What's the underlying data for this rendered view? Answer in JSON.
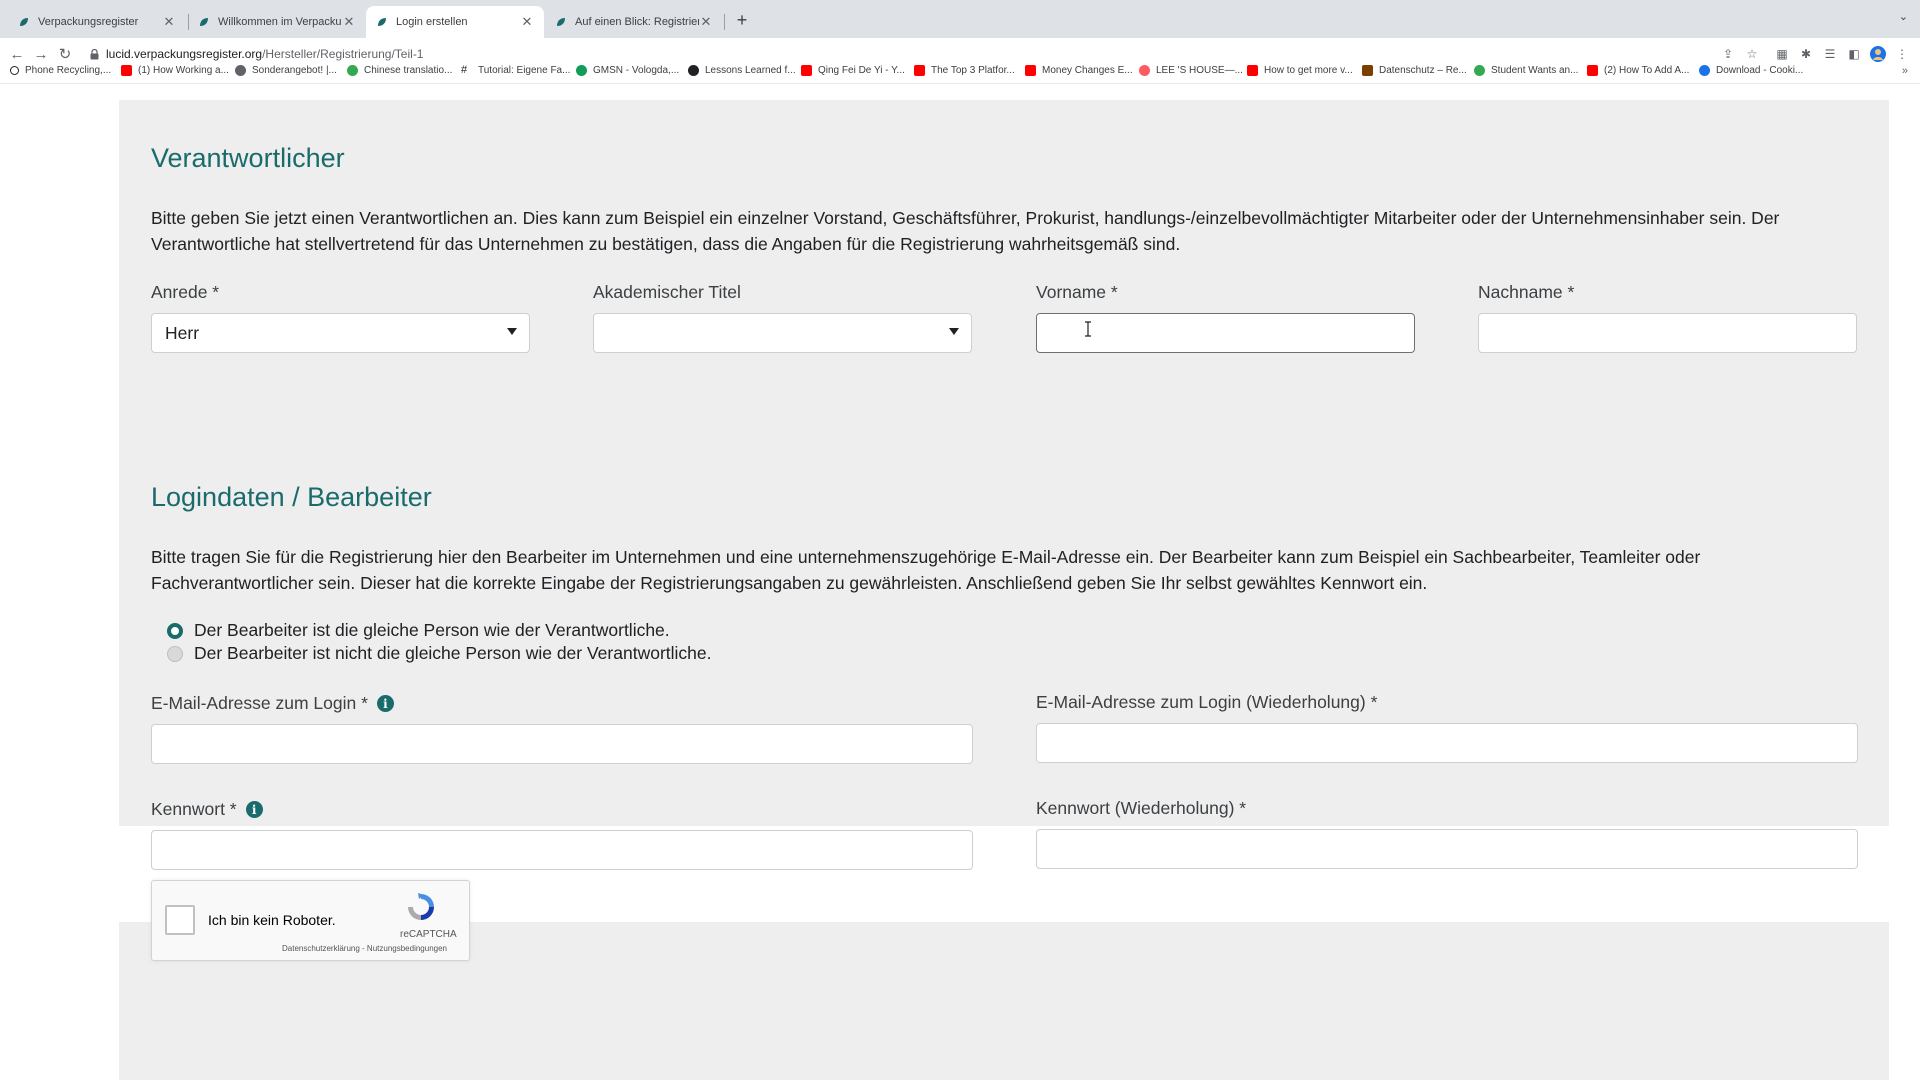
{
  "browser": {
    "tabs": [
      {
        "title": "Verpackungsregister",
        "active": false
      },
      {
        "title": "Willkommen im Verpackungsre",
        "active": false
      },
      {
        "title": "Login erstellen",
        "active": true
      },
      {
        "title": "Auf einen Blick: Registrierung",
        "active": false
      }
    ],
    "url_host": "lucid.verpackungsregister.org",
    "url_path": "/Hersteller/Registrierung/Teil-1",
    "bookmarks": [
      {
        "label": "Phone Recycling,...",
        "icon": "search-icon",
        "color": "#202124"
      },
      {
        "label": "(1) How Working a...",
        "icon": "youtube-icon",
        "color": "#ff0000"
      },
      {
        "label": "Sonderangebot! |...",
        "icon": "site-icon",
        "color": "#5f6368"
      },
      {
        "label": "Chinese translatio...",
        "icon": "site-icon",
        "color": "#34a853"
      },
      {
        "label": "Tutorial: Eigene Fa...",
        "icon": "hashtag-icon",
        "color": "#202124"
      },
      {
        "label": "GMSN - Vologda,...",
        "icon": "site-icon",
        "color": "#0f9d58"
      },
      {
        "label": "Lessons Learned f...",
        "icon": "site-icon",
        "color": "#202124"
      },
      {
        "label": "Qing Fei De Yi - Y...",
        "icon": "youtube-icon",
        "color": "#ff0000"
      },
      {
        "label": "The Top 3 Platfor...",
        "icon": "youtube-icon",
        "color": "#ff0000"
      },
      {
        "label": "Money Changes E...",
        "icon": "youtube-icon",
        "color": "#ff0000"
      },
      {
        "label": "LEE 'S HOUSE—...",
        "icon": "airbnb-icon",
        "color": "#ff5a5f"
      },
      {
        "label": "How to get more v...",
        "icon": "youtube-icon",
        "color": "#ff0000"
      },
      {
        "label": "Datenschutz – Re...",
        "icon": "site-icon",
        "color": "#7b3f00"
      },
      {
        "label": "Student Wants an...",
        "icon": "site-icon",
        "color": "#34a853"
      },
      {
        "label": "(2) How To Add A...",
        "icon": "youtube-icon",
        "color": "#ff0000"
      },
      {
        "label": "Download - Cooki...",
        "icon": "site-icon",
        "color": "#1a73e8"
      }
    ]
  },
  "section_responsible": {
    "title": "Verantwortlicher",
    "intro": "Bitte geben Sie jetzt einen Verantwortlichen an. Dies kann zum Beispiel ein einzelner Vorstand, Geschäftsführer, Prokurist, handlungs-/einzelbevollmächtigter Mitarbeiter oder der Unternehmensinhaber sein. Der Verantwortliche hat stellvertretend für das Unternehmen zu bestätigen, dass die Angaben für die Registrierung wahrheitsgemäß sind.",
    "salutation_label": "Anrede *",
    "salutation_value": "Herr",
    "title_label": "Akademischer Titel",
    "title_value": "",
    "firstname_label": "Vorname *",
    "firstname_value": "",
    "lastname_label": "Nachname *",
    "lastname_value": ""
  },
  "section_login": {
    "title": "Logindaten / Bearbeiter",
    "intro": "Bitte tragen Sie für die Registrierung hier den Bearbeiter im Unternehmen und eine unternehmenszugehörige E-Mail-Adresse ein. Der Bearbeiter kann zum Beispiel ein Sachbearbeiter, Teamleiter oder Fachverantwortlicher sein. Dieser hat die korrekte Eingabe der Registrierungsangaben zu gewährleisten. Anschließend geben Sie Ihr selbst gewähltes Kennwort ein.",
    "radio_same": "Der Bearbeiter ist die gleiche Person wie der Verantwortliche.",
    "radio_not_same": "Der Bearbeiter ist nicht die gleiche Person wie der Verantwortliche.",
    "email_label": "E-Mail-Adresse zum Login *",
    "email_repeat_label": "E-Mail-Adresse zum Login (Wiederholung) *",
    "password_label": "Kennwort *",
    "password_repeat_label": "Kennwort (Wiederholung) *"
  },
  "recaptcha": {
    "label": "Ich bin kein Roboter.",
    "brand": "reCAPTCHA",
    "links": "Datenschutzerklärung - Nutzungsbedingungen"
  },
  "colors": {
    "accent": "#1a6b6c",
    "panel_bg": "#eeeeee"
  }
}
